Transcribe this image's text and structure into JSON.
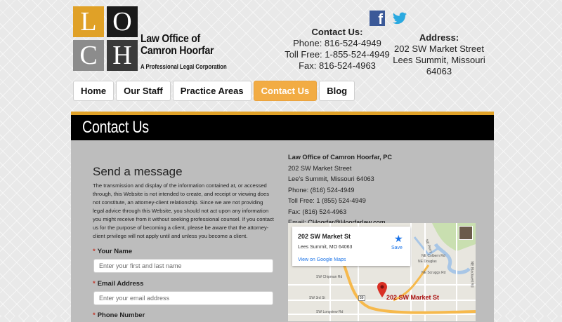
{
  "logo": {
    "letters": [
      "L",
      "O",
      "C",
      "H"
    ],
    "firm_line1": "Law Office of",
    "firm_line2": "Camron Hoorfar",
    "subtitle": "A Professional Legal Corporation"
  },
  "social": {
    "facebook_icon": "facebook-icon",
    "twitter_icon": "twitter-icon"
  },
  "contact": {
    "heading": "Contact Us:",
    "phone": "Phone: 816-524-4949",
    "tollfree": "Toll Free: 1-855-524-4949",
    "fax": "Fax: 816-524-4963"
  },
  "address": {
    "heading": "Address:",
    "line1": "202 SW Market Street",
    "line2": "Lees Summit, Missouri 64063"
  },
  "nav": {
    "items": [
      {
        "label": "Home"
      },
      {
        "label": "Our Staff"
      },
      {
        "label": "Practice Areas"
      },
      {
        "label": "Contact Us",
        "active": true
      },
      {
        "label": "Blog"
      }
    ]
  },
  "page": {
    "banner_title": "Contact Us",
    "send_heading": "Send a message",
    "disclaimer": "The transmission and display of the information contained at, or accessed through, this Website is not intended to create, and receipt or viewing does not constitute, an attorney-client relationship. Since we are not providing legal advice through this Website, you should not act upon any information you might receive from it without seeking professional counsel. If you contact us for the purpose of becoming a client, please be aware that the attorney-client privilege will not apply until and unless you become a client.",
    "form": {
      "name_label": "Your Name",
      "name_placeholder": "Enter your first and last name",
      "email_label": "Email Address",
      "email_placeholder": "Enter your email address",
      "phone_label": "Phone Number"
    }
  },
  "info": {
    "firm": "Law Office of Camron Hoorfar, PC",
    "street": "202 SW Market Street",
    "city": "Lee's Summit, Missouri 64063",
    "phone": "Phone: (816) 524-4949",
    "tollfree": "Toll Free: 1 (855) 524-4949",
    "fax": "Fax: (816) 524-4963",
    "email_prefix": "Email: ",
    "email": "CHoorfar@Hoorfarlaw.com"
  },
  "map": {
    "card_title": "202 SW Market St",
    "card_city": "Lees Summit, MO 64063",
    "card_link": "View on Google Maps",
    "save_label": "Save",
    "pin_label": "202 SW Market St",
    "roads": [
      "NE Colbern Rd",
      "NE Scruggs Rd",
      "NE Blackwell Rd",
      "NE Perry",
      "NE Douglas",
      "SW Chipman Rd",
      "SW 3rd St",
      "SW Longview Rd",
      "50"
    ],
    "colors": {
      "highway": "#f6b94c",
      "water": "#a8c6e6",
      "park": "#c9dfb0",
      "pin": "#d93025"
    }
  },
  "colors": {
    "accent": "#e0a127",
    "nav_active": "#f2ac44",
    "banner": "#000000",
    "panel": "#bdbdbd"
  }
}
